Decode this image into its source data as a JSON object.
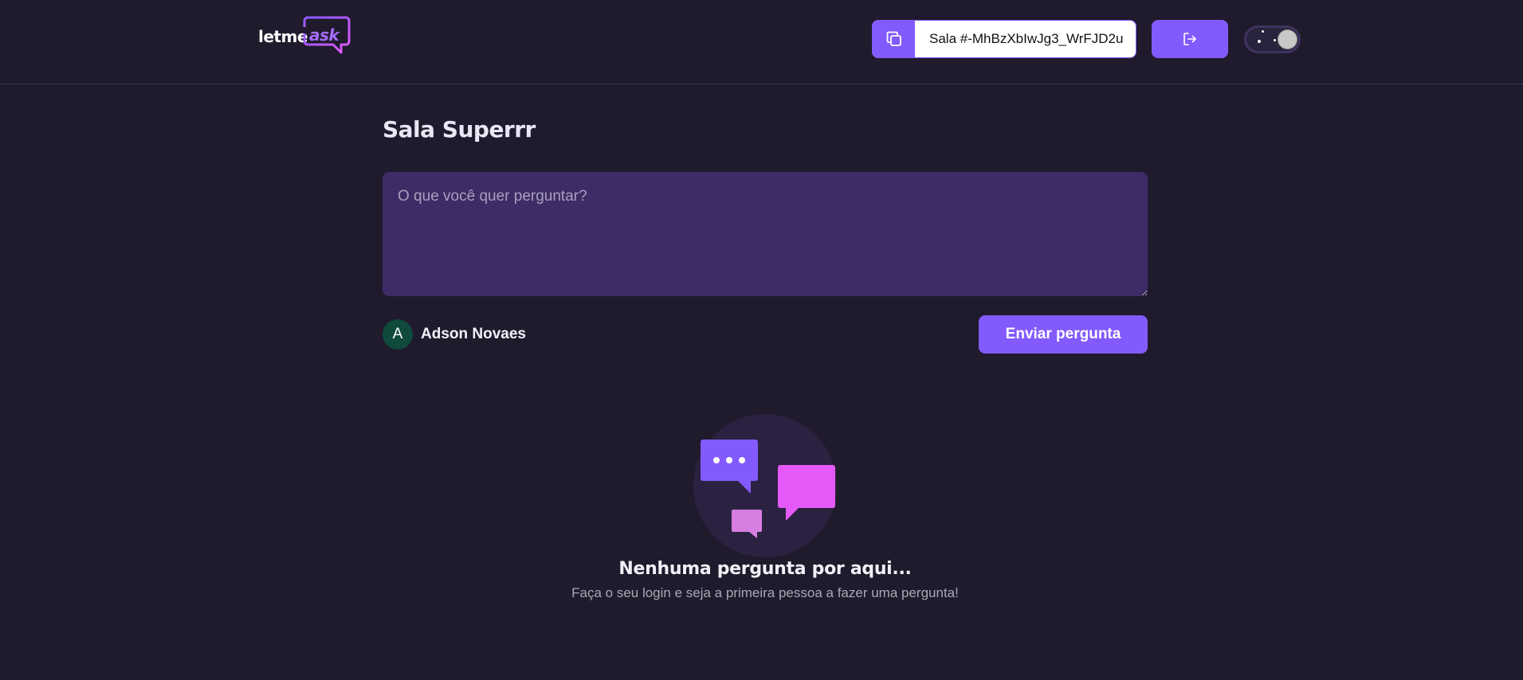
{
  "header": {
    "logo": {
      "part1": "letme",
      "part2": "ask"
    },
    "room_code": {
      "text": "Sala #-MhBzXbIwJg3_WrFJD2u",
      "copy_icon": "copy-icon"
    },
    "logout_icon": "logout-icon",
    "theme_toggle": {
      "state": "light",
      "icons": [
        "stars",
        "knob"
      ]
    }
  },
  "room": {
    "title": "Sala Superrr",
    "question_placeholder": "O que você quer perguntar?",
    "question_value": ""
  },
  "user": {
    "avatar_letter": "A",
    "name": "Adson Novaes"
  },
  "actions": {
    "send_label": "Enviar pergunta"
  },
  "empty_state": {
    "illustration": "chat-bubbles-illustration",
    "title": "Nenhuma pergunta por aqui...",
    "subtitle": "Faça o seu login e seja a primeira pessoa a fazer uma pergunta!"
  },
  "colors": {
    "background": "#1f1b2d",
    "accent": "#835afd",
    "input_bg": "#3e2c66",
    "avatar_bg": "#0f4a3d",
    "pink": "#e559f9"
  }
}
